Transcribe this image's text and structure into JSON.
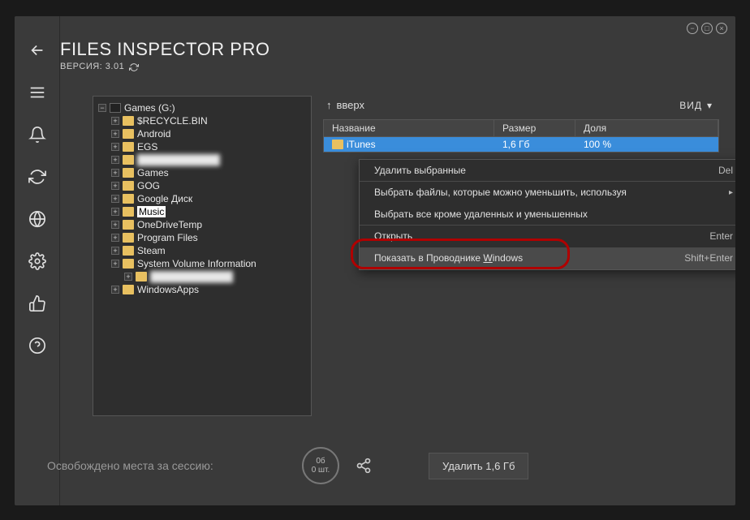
{
  "app": {
    "title": "FILES INSPECTOR PRO",
    "version_prefix": "ВЕРСИЯ: ",
    "version": "3.01"
  },
  "tree": {
    "root": "Games (G:)",
    "items": [
      {
        "label": "$RECYCLE.BIN"
      },
      {
        "label": "Android"
      },
      {
        "label": "EGS"
      },
      {
        "label": "",
        "blurred": true
      },
      {
        "label": "Games"
      },
      {
        "label": "GOG"
      },
      {
        "label": "Google Диск"
      },
      {
        "label": "Music",
        "selected": true
      },
      {
        "label": "OneDriveTemp"
      },
      {
        "label": "Program Files"
      },
      {
        "label": "Steam"
      },
      {
        "label": "System Volume Information"
      },
      {
        "label": "",
        "blurred": true,
        "indent": true
      },
      {
        "label": "WindowsApps"
      }
    ]
  },
  "toolbar": {
    "up": "вверх",
    "view": "ВИД"
  },
  "table": {
    "cols": {
      "name": "Название",
      "size": "Размер",
      "share": "Доля"
    },
    "row": {
      "name": "iTunes",
      "size": "1,6 Гб",
      "share": "100 %"
    }
  },
  "ctx": {
    "delete": "Удалить выбранные",
    "delete_key": "Del",
    "choose": "Выбрать файлы, которые можно уменьшить, используя",
    "choose_all": "Выбрать все кроме удаленных и уменьшенных",
    "open": "Открыть",
    "open_key": "Enter",
    "show_prefix": "Показать в Проводнике ",
    "show_win": "W",
    "show_suffix": "indows",
    "show_key": "Shift+Enter"
  },
  "footer": {
    "freed_label": "Освобождено места за сессию:",
    "freed_size": "0б",
    "freed_count": "0 шт.",
    "delete_btn": "Удалить 1,6 Гб"
  }
}
